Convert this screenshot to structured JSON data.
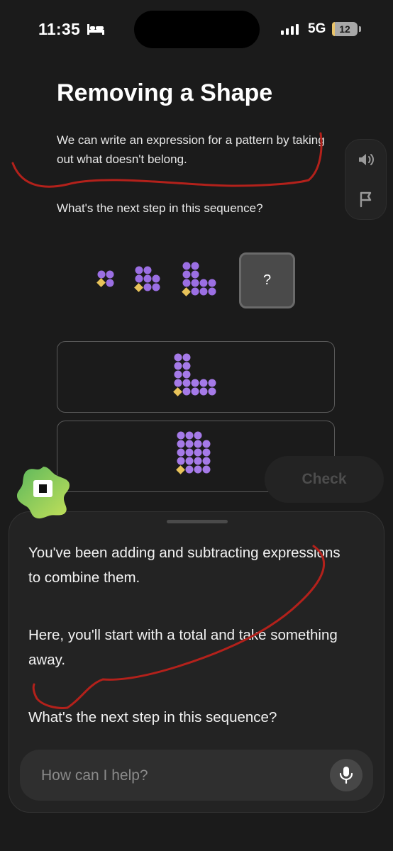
{
  "status_bar": {
    "time": "11:35",
    "network": "5G",
    "battery": "12",
    "battery_level": 0.12,
    "signal_bars": 4
  },
  "lesson": {
    "title": "Removing a Shape",
    "paragraph": "We can write an expression for a pattern by taking out what doesn't belong.",
    "question": "What's the next step in this sequence?"
  },
  "side_panel": {
    "icons": [
      "speaker-icon",
      "flag-icon"
    ]
  },
  "sequence": {
    "unknown_label": "?"
  },
  "check_label": "Check",
  "chat": {
    "messages": [
      "You've been adding and subtracting expressions to combine them.",
      "Here, you'll start with a total and take something away.",
      "What's the next step in this sequence?"
    ],
    "input_placeholder": "How can I help?"
  },
  "colors": {
    "accent_purple": "#9b6fe3",
    "accent_yellow": "#e8c35a",
    "mascot_green": "#6cc05a",
    "annotation_red": "#b3211b"
  }
}
